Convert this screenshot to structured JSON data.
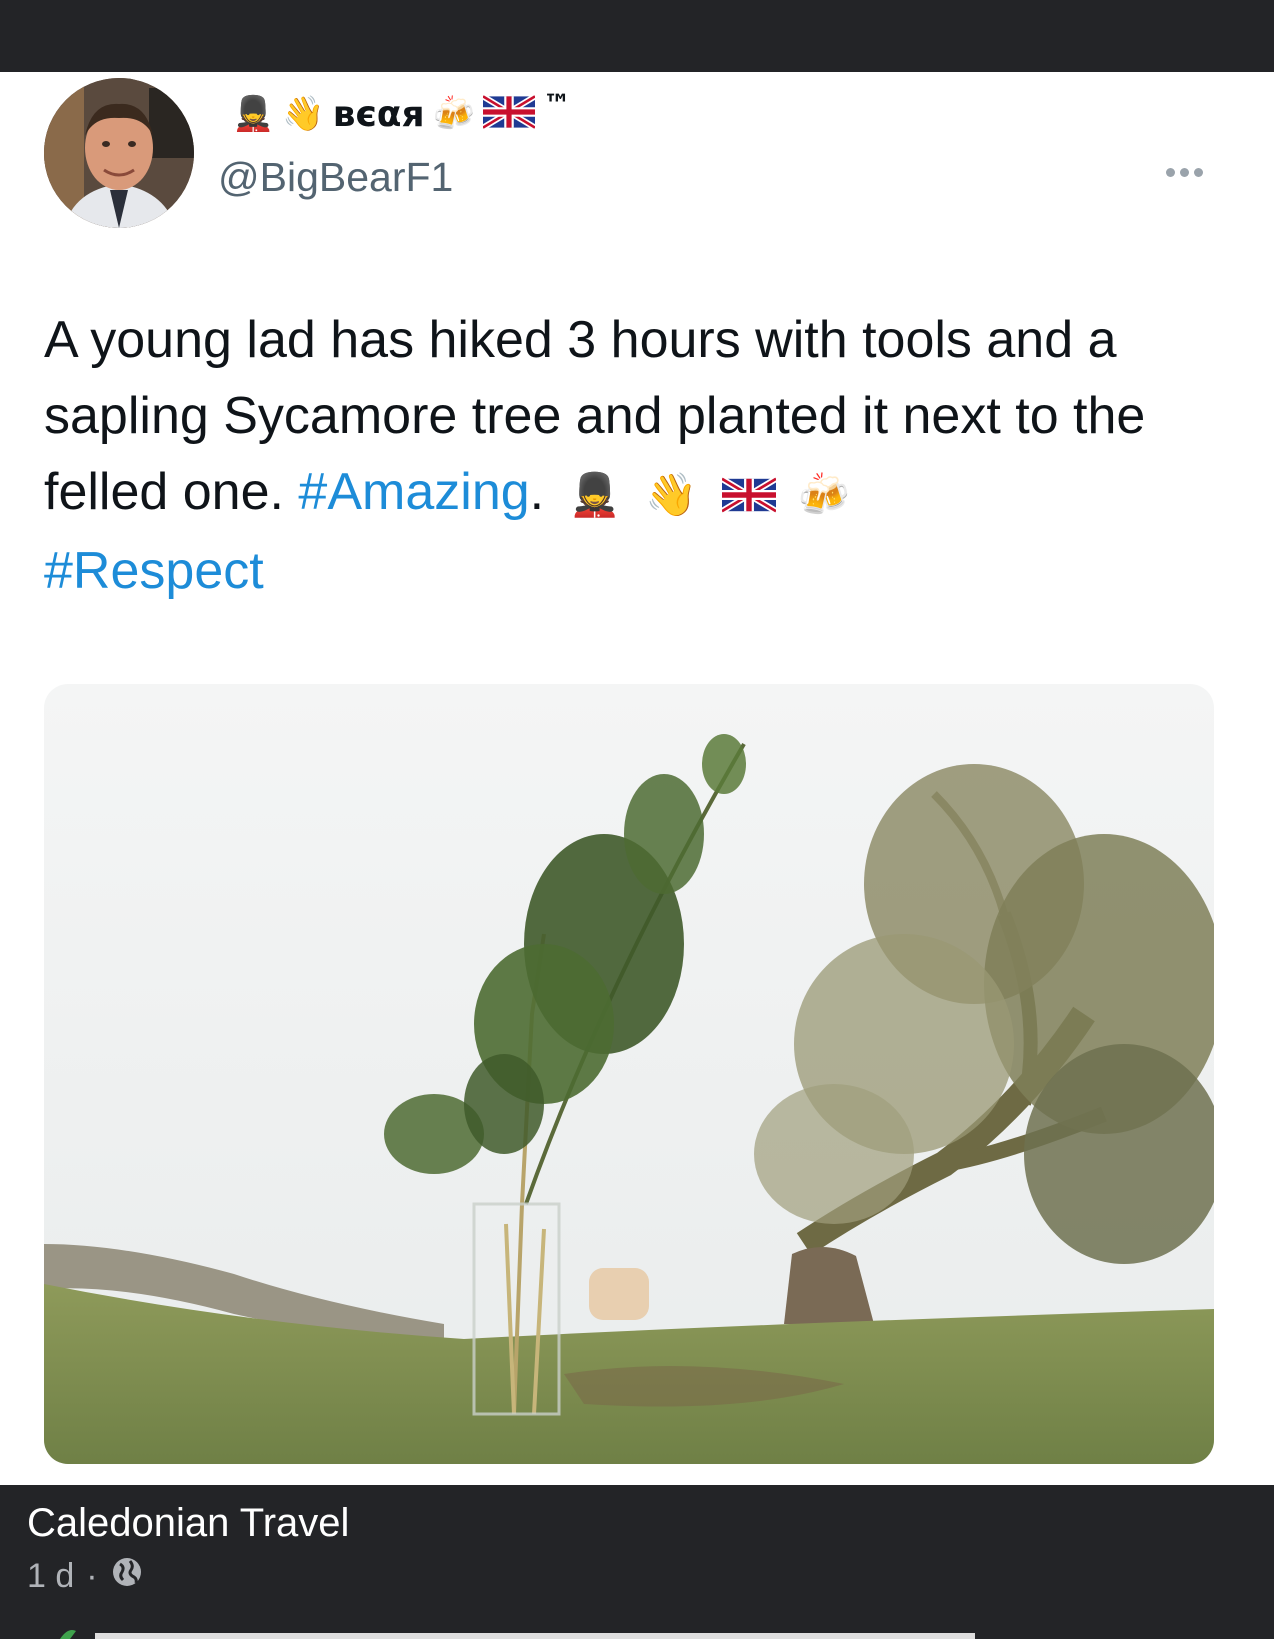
{
  "tweet": {
    "display_name": "вєαя",
    "name_suffix": "™",
    "handle": "@BigBearF1",
    "text_main": "A young lad has hiked 3 hours with tools and a sapling Sycamore tree and planted it next to the felled one.",
    "hashtag_1": "#Amazing",
    "after_hashtag_1": ".",
    "hashtag_2": "#Respect",
    "name_emoji": [
      "guard-emoji",
      "waving-hand-emoji",
      "beer-mugs-emoji",
      "uk-flag-emoji"
    ],
    "text_emoji": [
      "guard-emoji",
      "waving-hand-emoji",
      "uk-flag-emoji",
      "beer-mugs-emoji"
    ],
    "link_color": "#1d8cd8"
  },
  "footer": {
    "source_name": "Caledonian Travel",
    "time": "1 d",
    "separator": "·",
    "privacy_icon": "globe-icon"
  }
}
